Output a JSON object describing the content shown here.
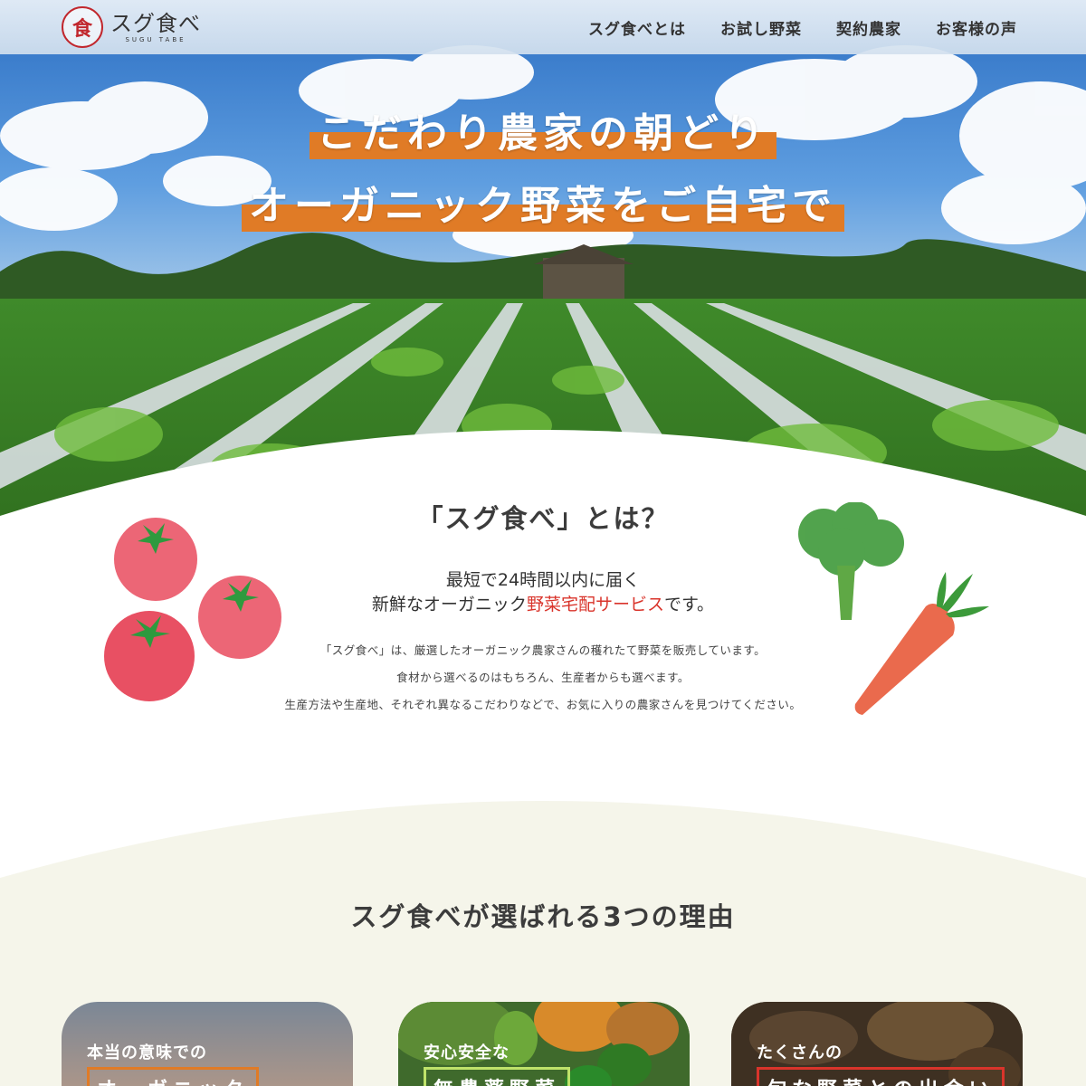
{
  "header": {
    "logo_mark": "食",
    "logo_name": "スグ食べ",
    "logo_sub": "SUGU TABE",
    "nav": [
      "スグ食べとは",
      "お試し野菜",
      "契約農家",
      "お客様の声"
    ]
  },
  "hero": {
    "line1": "こだわり農家の朝どり",
    "line2": "オーガニック野菜をご自宅で"
  },
  "about": {
    "title": "「スグ食べ」とは？",
    "lead1": "最短で24時間以内に届く",
    "lead2_prefix": "新鮮なオーガニック",
    "lead2_highlight": "野菜宅配サービス",
    "lead2_suffix": "です。",
    "body": [
      "「スグ食べ」は、厳選したオーガニック農家さんの穫れたて野菜を販売しています。",
      "食材から選べるのはもちろん、生産者からも選べます。",
      "生産方法や生産地、それぞれ異なるこだわりなどで、お気に入りの農家さんを見つけてください。"
    ]
  },
  "reasons": {
    "title": "スグ食べが選ばれる3つの理由",
    "cards": [
      {
        "label": "本当の意味での",
        "highlight": "オーガニック"
      },
      {
        "label": "安心安全な",
        "highlight": "無農薬野菜"
      },
      {
        "label": "たくさんの",
        "highlight": "旬な野菜との出会い"
      }
    ]
  },
  "colors": {
    "accent_orange": "#e07b26",
    "accent_red": "#d9342b",
    "cream": "#f5f5ea"
  }
}
